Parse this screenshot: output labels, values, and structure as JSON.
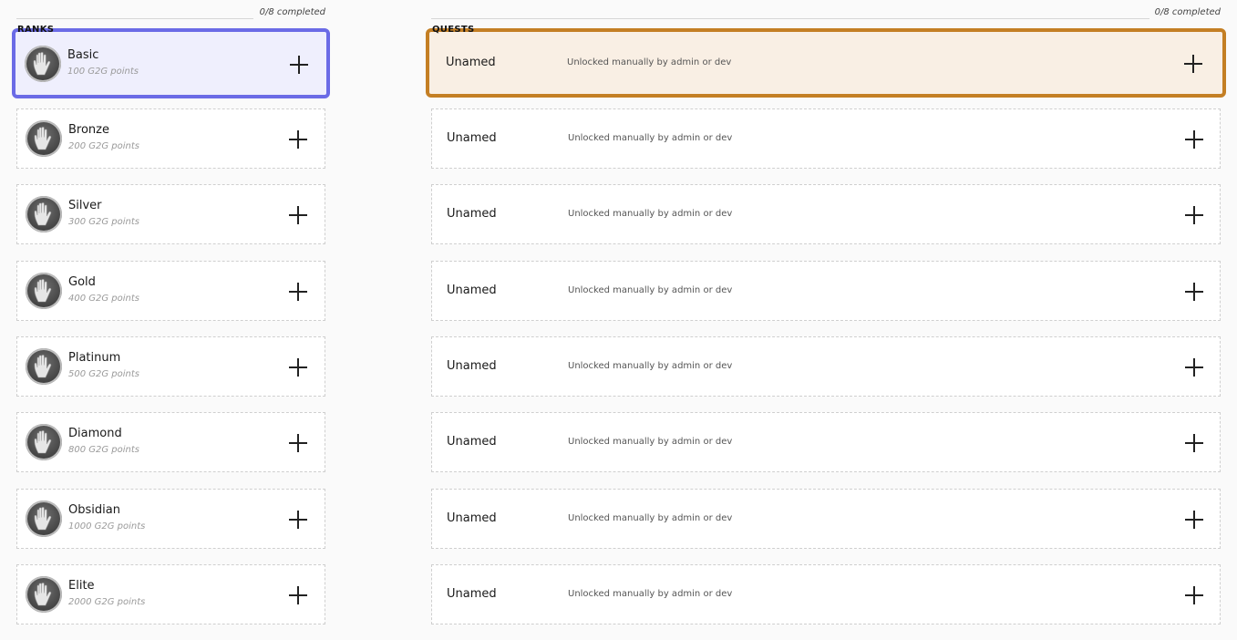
{
  "ranks": {
    "title": "RANKS",
    "progress": "0/8 completed",
    "items": [
      {
        "name": "Basic",
        "points": "100 G2G points"
      },
      {
        "name": "Bronze",
        "points": "200 G2G points"
      },
      {
        "name": "Silver",
        "points": "300 G2G points"
      },
      {
        "name": "Gold",
        "points": "400 G2G points"
      },
      {
        "name": "Platinum",
        "points": "500 G2G points"
      },
      {
        "name": "Diamond",
        "points": "800 G2G points"
      },
      {
        "name": "Obsidian",
        "points": "1000 G2G points"
      },
      {
        "name": "Elite",
        "points": "2000 G2G points"
      }
    ]
  },
  "quests": {
    "title": "QUESTS",
    "progress": "0/8 completed",
    "items": [
      {
        "name": "Unamed",
        "description": "Unlocked manually by admin or dev"
      },
      {
        "name": "Unamed",
        "description": "Unlocked manually by admin or dev"
      },
      {
        "name": "Unamed",
        "description": "Unlocked manually by admin or dev"
      },
      {
        "name": "Unamed",
        "description": "Unlocked manually by admin or dev"
      },
      {
        "name": "Unamed",
        "description": "Unlocked manually by admin or dev"
      },
      {
        "name": "Unamed",
        "description": "Unlocked manually by admin or dev"
      },
      {
        "name": "Unamed",
        "description": "Unlocked manually by admin or dev"
      },
      {
        "name": "Unamed",
        "description": "Unlocked manually by admin or dev"
      }
    ]
  },
  "colors": {
    "rank_selected_border": "#6b6be6",
    "rank_selected_bg": "#efeffd",
    "quest_selected_border": "#c47f24",
    "quest_selected_bg": "#f9efe4"
  },
  "icons": {
    "rank_avatar": "raised-hand-icon",
    "add": "plus-icon"
  }
}
